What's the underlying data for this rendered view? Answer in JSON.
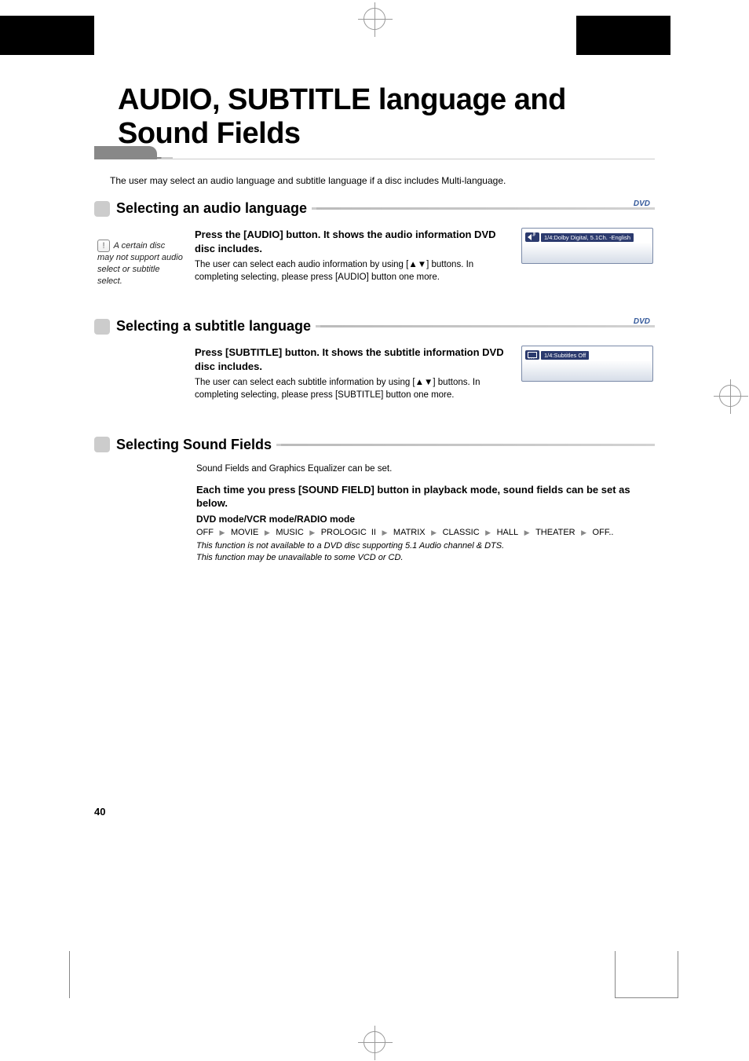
{
  "page": {
    "title": "AUDIO, SUBTITLE language and Sound Fields",
    "intro": "The user may select an audio language and subtitle language if a disc includes Multi-language.",
    "number": "40"
  },
  "section1": {
    "title": "Selecting an audio language",
    "badge": "DVD",
    "note": "A certain disc may not support audio select or subtitle select.",
    "head": "Press the [AUDIO] button. It shows the audio information DVD disc includes.",
    "body": "The user can select each audio information by using [▲▼] buttons. In completing selecting, please press [AUDIO] button one more.",
    "osd": "1/4:Dolby Digital, 5.1Ch. -English"
  },
  "section2": {
    "title": "Selecting a subtitle language",
    "badge": "DVD",
    "head": "Press [SUBTITLE] button. It shows the subtitle information DVD disc includes.",
    "body": "The user can select each subtitle information by using [▲▼] buttons. In completing selecting, please press [SUBTITLE] button one more.",
    "osd": "1/4:Subtitles Off"
  },
  "section3": {
    "title": "Selecting Sound Fields",
    "intro": "Sound Fields and Graphics Equalizer can be set.",
    "head": "Each time you press [SOUND FIELD] button in playback mode, sound fields can be set as below.",
    "mode": "DVD mode/VCR mode/RADIO mode",
    "seq": [
      "OFF",
      "MOVIE",
      "MUSIC",
      "PROLOGIC II",
      "MATRIX",
      "CLASSIC",
      "HALL",
      "THEATER",
      "OFF.."
    ],
    "note1": "This function is not available to a DVD disc supporting 5.1 Audio channel & DTS.",
    "note2": "This function may be unavailable to some VCD or CD."
  }
}
